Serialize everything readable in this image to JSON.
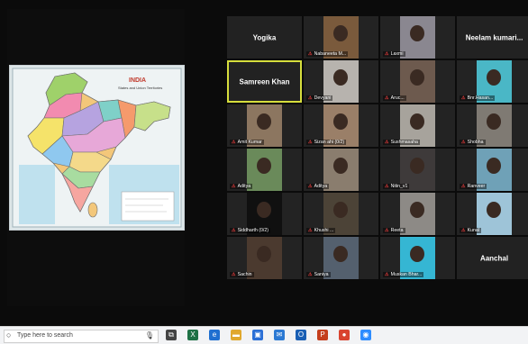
{
  "map": {
    "title": "INDIA",
    "subtitle": "States and Union Territories"
  },
  "gallery": {
    "tiles": [
      {
        "name": "Yogika",
        "type": "name"
      },
      {
        "label": "Nabaneeta M...",
        "type": "video",
        "bg": "#7a5a3c"
      },
      {
        "label": "Laxmi",
        "type": "video",
        "bg": "#8a8790"
      },
      {
        "name": "Neelam kumari...",
        "type": "name"
      },
      {
        "name": "Samreen Khan",
        "type": "name",
        "active": true
      },
      {
        "label": "Devyani",
        "type": "video",
        "bg": "#b7b3ae"
      },
      {
        "label": "Aruc...",
        "type": "video",
        "bg": "#6d5a4e"
      },
      {
        "label": "Bnr.Hasan...",
        "type": "video",
        "bg": "#4ab7c6"
      },
      {
        "label": "Amit Kumar",
        "type": "video",
        "bg": "#8c7660"
      },
      {
        "label": "Sizan ahi (0/2)",
        "type": "video",
        "bg": "#9a7f68"
      },
      {
        "label": "Sushmasaha",
        "type": "video",
        "bg": "#a7a39c"
      },
      {
        "label": "Shobha",
        "type": "video",
        "bg": "#7f7a73"
      },
      {
        "label": "Aditya",
        "type": "video",
        "bg": "#6a8a5a"
      },
      {
        "label": "Aditya",
        "type": "video",
        "bg": "#8a7d6e"
      },
      {
        "label": "Nitin_v1",
        "type": "video",
        "bg": "#3e3a3a"
      },
      {
        "label": "Ranveer",
        "type": "video",
        "bg": "#6fa1b7"
      },
      {
        "label": "Siddharth (0/2)",
        "type": "video",
        "bg": "#101010"
      },
      {
        "label": "Khushi ...",
        "type": "video",
        "bg": "#4c4337"
      },
      {
        "label": "Reeta",
        "type": "video",
        "bg": "#8d8a86"
      },
      {
        "label": "Kunal",
        "type": "video",
        "bg": "#9ec4d8"
      },
      {
        "label": "Sachin",
        "type": "video",
        "bg": "#4b3a2f"
      },
      {
        "label": "Saniya",
        "type": "video",
        "bg": "#54606e"
      },
      {
        "label": "Muskan Bhar...",
        "type": "video",
        "bg": "#35b6d3"
      },
      {
        "name": "Aanchal",
        "type": "name"
      }
    ]
  },
  "taskbar": {
    "search_placeholder": "Type here to search",
    "icons": [
      {
        "name": "task-view",
        "color": "#444444",
        "glyph": "⧉"
      },
      {
        "name": "excel",
        "color": "#1e7145",
        "glyph": "X"
      },
      {
        "name": "edge",
        "color": "#1f6fd0",
        "glyph": "e"
      },
      {
        "name": "file-explorer",
        "color": "#e0a82e",
        "glyph": "▬"
      },
      {
        "name": "store",
        "color": "#2a6fd6",
        "glyph": "▣"
      },
      {
        "name": "mail",
        "color": "#2b79d3",
        "glyph": "✉"
      },
      {
        "name": "outlook",
        "color": "#1a5fb4",
        "glyph": "O"
      },
      {
        "name": "powerpoint",
        "color": "#c43e1c",
        "glyph": "P"
      },
      {
        "name": "chrome",
        "color": "#d9442f",
        "glyph": "●"
      },
      {
        "name": "zoom",
        "color": "#2d8cff",
        "glyph": "◉"
      }
    ]
  }
}
